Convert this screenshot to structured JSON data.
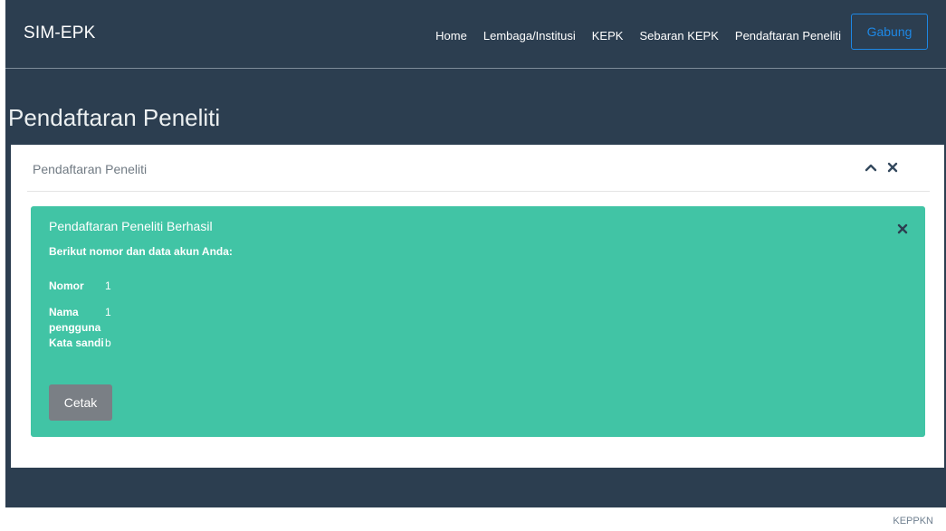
{
  "brand": "SIM-EPK",
  "nav": {
    "links": [
      "Home",
      "Lembaga/Institusi",
      "KEPK",
      "Sebaran KEPK",
      "Pendaftaran Peneliti"
    ],
    "join_label": "Gabung"
  },
  "page_title": "Pendaftaran Peneliti",
  "panel": {
    "title": "Pendaftaran Peneliti",
    "tools": [
      "chevron-up-icon",
      "close-icon"
    ]
  },
  "alert": {
    "title": "Pendaftaran Peneliti Berhasil",
    "subtitle": "Berikut nomor dan data akun Anda:",
    "rows": [
      {
        "label": "Nomor",
        "value": "1"
      },
      {
        "label": "Nama pengguna",
        "value": "1"
      },
      {
        "label": "Kata sandi",
        "value": "b"
      }
    ],
    "print_label": "Cetak"
  },
  "footer": "KEPPKN",
  "colors": {
    "navy": "#2c3e50",
    "success": "#41c4a5",
    "join_blue": "#1e88e5",
    "print_gray": "#7a7f85"
  }
}
